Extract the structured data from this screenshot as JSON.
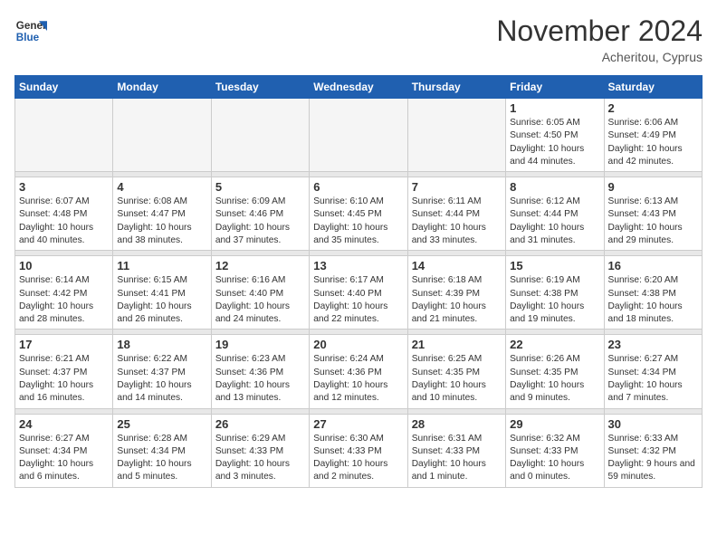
{
  "logo": {
    "general": "General",
    "blue": "Blue"
  },
  "title": "November 2024",
  "location": "Acheritou, Cyprus",
  "weekdays": [
    "Sunday",
    "Monday",
    "Tuesday",
    "Wednesday",
    "Thursday",
    "Friday",
    "Saturday"
  ],
  "weeks": [
    [
      {
        "day": "",
        "info": ""
      },
      {
        "day": "",
        "info": ""
      },
      {
        "day": "",
        "info": ""
      },
      {
        "day": "",
        "info": ""
      },
      {
        "day": "",
        "info": ""
      },
      {
        "day": "1",
        "sunrise": "Sunrise: 6:05 AM",
        "sunset": "Sunset: 4:50 PM",
        "daylight": "Daylight: 10 hours and 44 minutes."
      },
      {
        "day": "2",
        "sunrise": "Sunrise: 6:06 AM",
        "sunset": "Sunset: 4:49 PM",
        "daylight": "Daylight: 10 hours and 42 minutes."
      }
    ],
    [
      {
        "day": "3",
        "sunrise": "Sunrise: 6:07 AM",
        "sunset": "Sunset: 4:48 PM",
        "daylight": "Daylight: 10 hours and 40 minutes."
      },
      {
        "day": "4",
        "sunrise": "Sunrise: 6:08 AM",
        "sunset": "Sunset: 4:47 PM",
        "daylight": "Daylight: 10 hours and 38 minutes."
      },
      {
        "day": "5",
        "sunrise": "Sunrise: 6:09 AM",
        "sunset": "Sunset: 4:46 PM",
        "daylight": "Daylight: 10 hours and 37 minutes."
      },
      {
        "day": "6",
        "sunrise": "Sunrise: 6:10 AM",
        "sunset": "Sunset: 4:45 PM",
        "daylight": "Daylight: 10 hours and 35 minutes."
      },
      {
        "day": "7",
        "sunrise": "Sunrise: 6:11 AM",
        "sunset": "Sunset: 4:44 PM",
        "daylight": "Daylight: 10 hours and 33 minutes."
      },
      {
        "day": "8",
        "sunrise": "Sunrise: 6:12 AM",
        "sunset": "Sunset: 4:44 PM",
        "daylight": "Daylight: 10 hours and 31 minutes."
      },
      {
        "day": "9",
        "sunrise": "Sunrise: 6:13 AM",
        "sunset": "Sunset: 4:43 PM",
        "daylight": "Daylight: 10 hours and 29 minutes."
      }
    ],
    [
      {
        "day": "10",
        "sunrise": "Sunrise: 6:14 AM",
        "sunset": "Sunset: 4:42 PM",
        "daylight": "Daylight: 10 hours and 28 minutes."
      },
      {
        "day": "11",
        "sunrise": "Sunrise: 6:15 AM",
        "sunset": "Sunset: 4:41 PM",
        "daylight": "Daylight: 10 hours and 26 minutes."
      },
      {
        "day": "12",
        "sunrise": "Sunrise: 6:16 AM",
        "sunset": "Sunset: 4:40 PM",
        "daylight": "Daylight: 10 hours and 24 minutes."
      },
      {
        "day": "13",
        "sunrise": "Sunrise: 6:17 AM",
        "sunset": "Sunset: 4:40 PM",
        "daylight": "Daylight: 10 hours and 22 minutes."
      },
      {
        "day": "14",
        "sunrise": "Sunrise: 6:18 AM",
        "sunset": "Sunset: 4:39 PM",
        "daylight": "Daylight: 10 hours and 21 minutes."
      },
      {
        "day": "15",
        "sunrise": "Sunrise: 6:19 AM",
        "sunset": "Sunset: 4:38 PM",
        "daylight": "Daylight: 10 hours and 19 minutes."
      },
      {
        "day": "16",
        "sunrise": "Sunrise: 6:20 AM",
        "sunset": "Sunset: 4:38 PM",
        "daylight": "Daylight: 10 hours and 18 minutes."
      }
    ],
    [
      {
        "day": "17",
        "sunrise": "Sunrise: 6:21 AM",
        "sunset": "Sunset: 4:37 PM",
        "daylight": "Daylight: 10 hours and 16 minutes."
      },
      {
        "day": "18",
        "sunrise": "Sunrise: 6:22 AM",
        "sunset": "Sunset: 4:37 PM",
        "daylight": "Daylight: 10 hours and 14 minutes."
      },
      {
        "day": "19",
        "sunrise": "Sunrise: 6:23 AM",
        "sunset": "Sunset: 4:36 PM",
        "daylight": "Daylight: 10 hours and 13 minutes."
      },
      {
        "day": "20",
        "sunrise": "Sunrise: 6:24 AM",
        "sunset": "Sunset: 4:36 PM",
        "daylight": "Daylight: 10 hours and 12 minutes."
      },
      {
        "day": "21",
        "sunrise": "Sunrise: 6:25 AM",
        "sunset": "Sunset: 4:35 PM",
        "daylight": "Daylight: 10 hours and 10 minutes."
      },
      {
        "day": "22",
        "sunrise": "Sunrise: 6:26 AM",
        "sunset": "Sunset: 4:35 PM",
        "daylight": "Daylight: 10 hours and 9 minutes."
      },
      {
        "day": "23",
        "sunrise": "Sunrise: 6:27 AM",
        "sunset": "Sunset: 4:34 PM",
        "daylight": "Daylight: 10 hours and 7 minutes."
      }
    ],
    [
      {
        "day": "24",
        "sunrise": "Sunrise: 6:27 AM",
        "sunset": "Sunset: 4:34 PM",
        "daylight": "Daylight: 10 hours and 6 minutes."
      },
      {
        "day": "25",
        "sunrise": "Sunrise: 6:28 AM",
        "sunset": "Sunset: 4:34 PM",
        "daylight": "Daylight: 10 hours and 5 minutes."
      },
      {
        "day": "26",
        "sunrise": "Sunrise: 6:29 AM",
        "sunset": "Sunset: 4:33 PM",
        "daylight": "Daylight: 10 hours and 3 minutes."
      },
      {
        "day": "27",
        "sunrise": "Sunrise: 6:30 AM",
        "sunset": "Sunset: 4:33 PM",
        "daylight": "Daylight: 10 hours and 2 minutes."
      },
      {
        "day": "28",
        "sunrise": "Sunrise: 6:31 AM",
        "sunset": "Sunset: 4:33 PM",
        "daylight": "Daylight: 10 hours and 1 minute."
      },
      {
        "day": "29",
        "sunrise": "Sunrise: 6:32 AM",
        "sunset": "Sunset: 4:33 PM",
        "daylight": "Daylight: 10 hours and 0 minutes."
      },
      {
        "day": "30",
        "sunrise": "Sunrise: 6:33 AM",
        "sunset": "Sunset: 4:32 PM",
        "daylight": "Daylight: 9 hours and 59 minutes."
      }
    ]
  ]
}
